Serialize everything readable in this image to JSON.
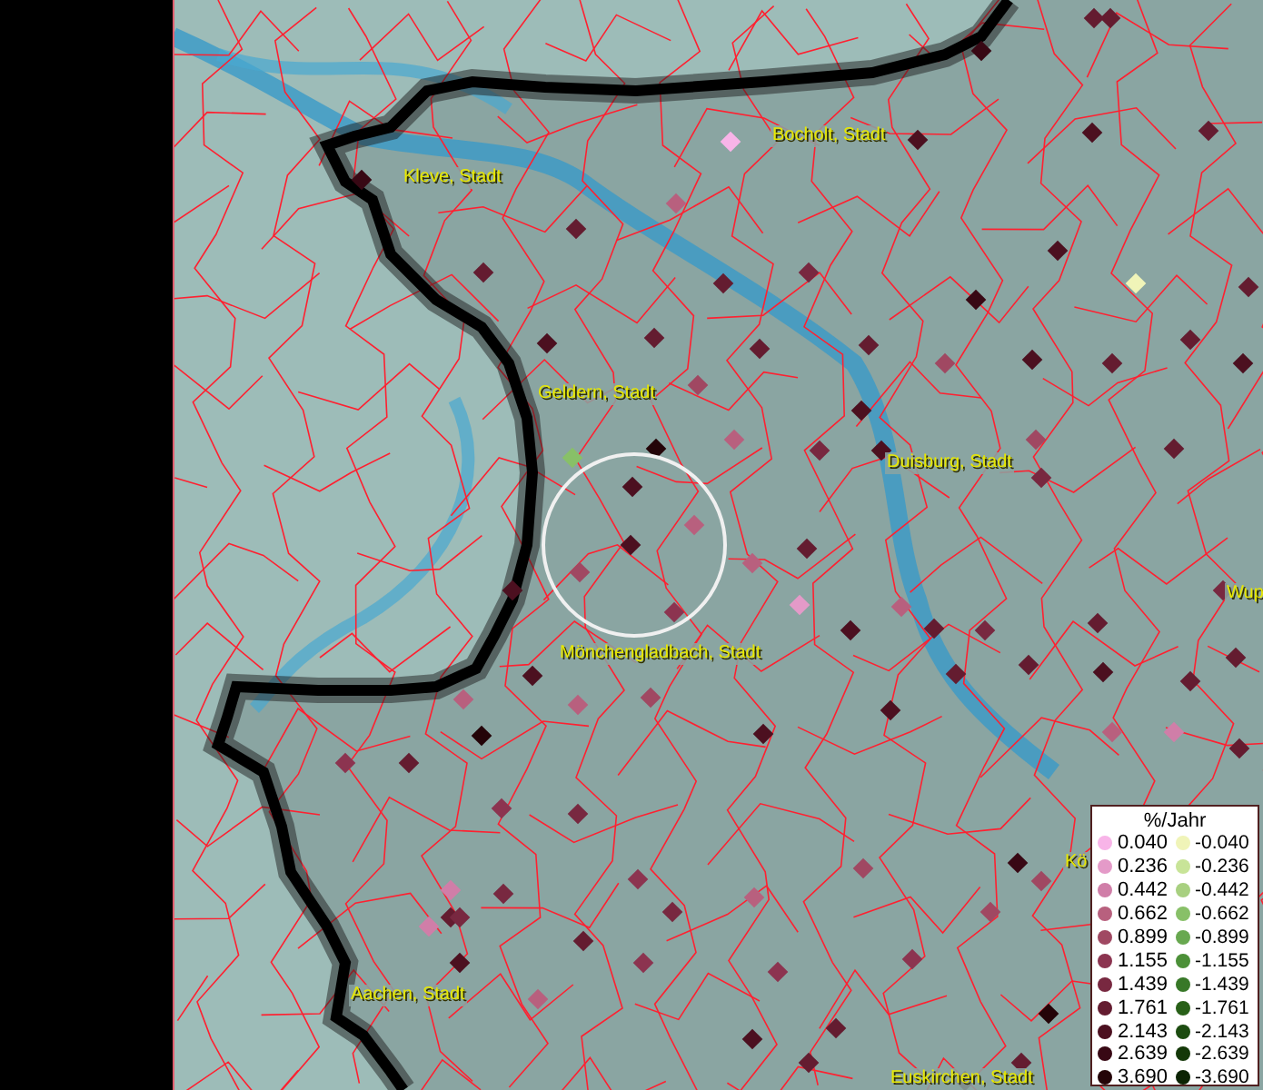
{
  "map": {
    "labels": [
      {
        "text": "Bocholt, Stadt"
      },
      {
        "text": "Kleve, Stadt"
      },
      {
        "text": "Geldern, Stadt"
      },
      {
        "text": "Duisburg, Stadt"
      },
      {
        "text": "Mönchengladbach, Stadt"
      },
      {
        "text": "Wup"
      },
      {
        "text": "Kö"
      },
      {
        "text": "Aachen, Stadt"
      },
      {
        "text": "Euskirchen, Stadt"
      }
    ]
  },
  "legend": {
    "title": "%/Jahr",
    "columns": [
      {
        "entries": [
          {
            "label": "0.040",
            "color": "#f8b4e8"
          },
          {
            "label": "0.236",
            "color": "#e49ac8"
          },
          {
            "label": "0.442",
            "color": "#d07ea8"
          },
          {
            "label": "0.662",
            "color": "#b8607e"
          },
          {
            "label": "0.899",
            "color": "#a04862"
          },
          {
            "label": "1.155",
            "color": "#8c3450"
          },
          {
            "label": "1.439",
            "color": "#782840"
          },
          {
            "label": "1.761",
            "color": "#641c30"
          },
          {
            "label": "2.143",
            "color": "#4c1020"
          },
          {
            "label": "2.639",
            "color": "#380814"
          },
          {
            "label": "3.690",
            "color": "#240408"
          }
        ]
      },
      {
        "entries": [
          {
            "label": "-0.040",
            "color": "#f0f4b8"
          },
          {
            "label": "-0.236",
            "color": "#c8e498"
          },
          {
            "label": "-0.442",
            "color": "#a8d080"
          },
          {
            "label": "-0.662",
            "color": "#88c068"
          },
          {
            "label": "-0.899",
            "color": "#68a850"
          },
          {
            "label": "-1.155",
            "color": "#4c9038"
          },
          {
            "label": "-1.439",
            "color": "#387828"
          },
          {
            "label": "-1.761",
            "color": "#286018"
          },
          {
            "label": "-2.143",
            "color": "#1c4c10"
          },
          {
            "label": "-2.639",
            "color": "#143808"
          },
          {
            "label": "-3.690",
            "color": "#0c2404"
          }
        ]
      }
    ]
  }
}
